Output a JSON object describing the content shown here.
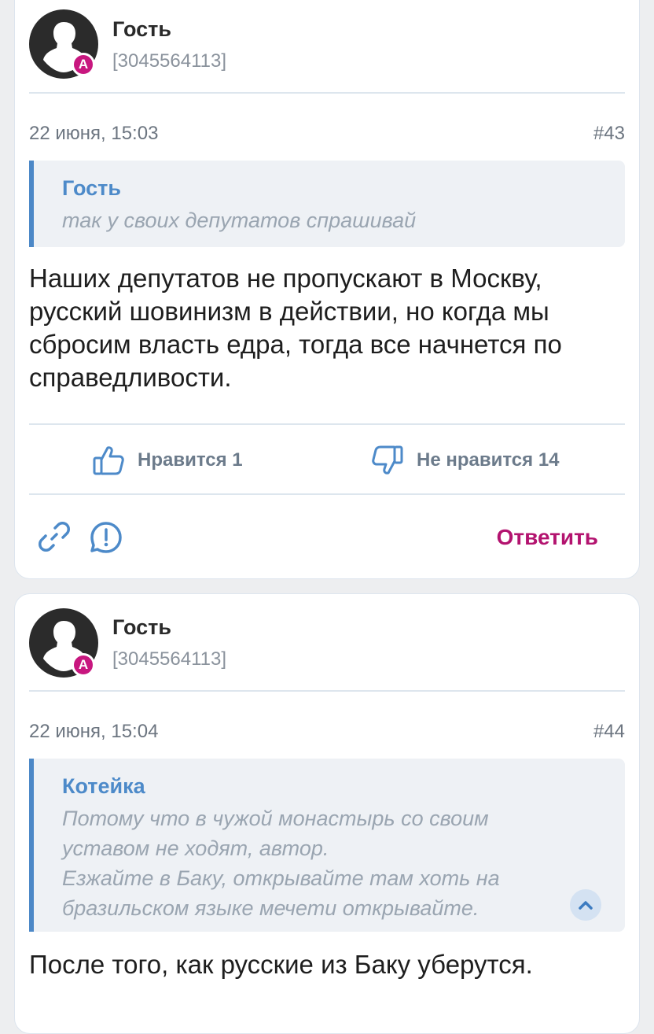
{
  "posts": [
    {
      "author": "Гость",
      "user_id": "[3045564113]",
      "badge": "А",
      "date": "22 июня, 15:03",
      "number": "#43",
      "quote": {
        "author": "Гость",
        "text": "так у своих депутатов спрашивай"
      },
      "text": "Наших депутатов не пропускают в Москву, русский шовинизм в действии, но когда мы сбросим власть едра, тогда все начнется по справедливости.",
      "like_label": "Нравится 1",
      "dislike_label": "Не нравится 14",
      "reply_label": "Ответить"
    },
    {
      "author": "Гость",
      "user_id": "[3045564113]",
      "badge": "А",
      "date": "22 июня, 15:04",
      "number": "#44",
      "quote": {
        "author": "Котейка",
        "text": "Потому что в чужой монастырь со своим\nуставом не ходят, автор.\nЕзжайте в Баку, открывайте там хоть на\nбразильском языке мечети открывайте."
      },
      "text": "После того, как русские из Баку уберутся."
    }
  ],
  "icons": {
    "avatar": "user-silhouette-icon",
    "like": "thumbs-up-icon",
    "dislike": "thumbs-down-icon",
    "link": "link-icon",
    "report": "exclamation-circle-icon",
    "collapse": "chevron-up-icon"
  },
  "colors": {
    "accent_blue": "#4d8ac9",
    "reply_magenta": "#b3136f",
    "badge_magenta": "#c8177f"
  }
}
